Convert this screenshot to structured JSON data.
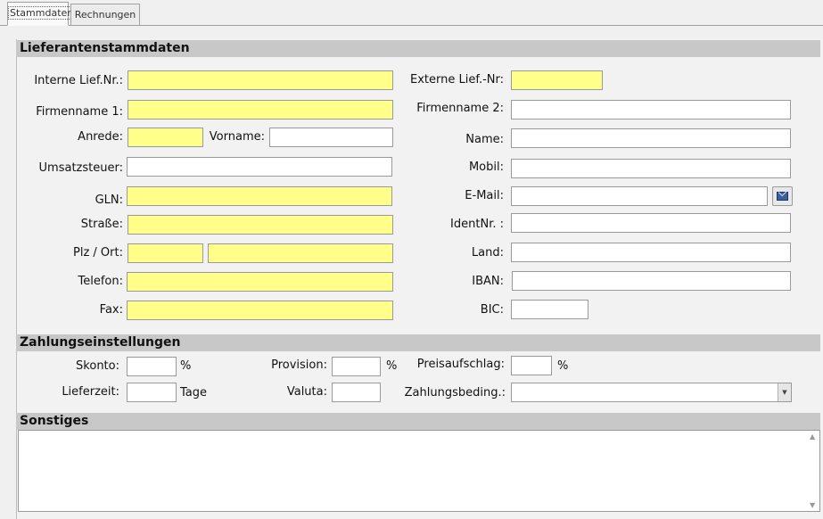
{
  "tabs": [
    {
      "label": "Stammdaten",
      "active": true
    },
    {
      "label": "Rechnungen",
      "active": false
    }
  ],
  "sections": {
    "stamm": "Lieferantenstammdaten",
    "zahlung": "Zahlungseinstellungen",
    "sonstiges": "Sonstiges"
  },
  "labels": {
    "interne_lief_nr": "Interne Lief.Nr.:",
    "externe_lief_nr": "Externe Lief.-Nr:",
    "firmenname1": "Firmenname 1:",
    "firmenname2": "Firmenname 2:",
    "anrede": "Anrede:",
    "vorname": "Vorname:",
    "name": "Name:",
    "umsatzsteuer": "Umsatzsteuer:",
    "mobil": "Mobil:",
    "gln": "GLN:",
    "email": "E-Mail:",
    "strasse": "Straße:",
    "identnr": "IdentNr. :",
    "plz_ort": "Plz / Ort:",
    "land": "Land:",
    "telefon": "Telefon:",
    "iban": "IBAN:",
    "fax": "Fax:",
    "bic": "BIC:",
    "skonto": "Skonto:",
    "provision": "Provision:",
    "preisaufschlag": "Preisaufschlag:",
    "lieferzeit": "Lieferzeit:",
    "valuta": "Valuta:",
    "zahlungsbeding": "Zahlungsbeding.:",
    "percent": "%",
    "tage": "Tage"
  },
  "values": {
    "interne_lief_nr": "",
    "externe_lief_nr": "",
    "firmenname1": "",
    "firmenname2": "",
    "anrede": "",
    "vorname": "",
    "name": "",
    "umsatzsteuer": "",
    "mobil": "",
    "gln": "",
    "email": "",
    "strasse": "",
    "identnr": "",
    "plz": "",
    "ort": "",
    "land": "",
    "telefon": "",
    "iban": "",
    "fax": "",
    "bic": "",
    "skonto": "",
    "provision": "",
    "preisaufschlag": "",
    "lieferzeit": "",
    "valuta": "",
    "zahlungsbeding": "",
    "sonstiges": ""
  },
  "colors": {
    "required": "#ffff8a",
    "section": "#c8c8c8",
    "background": "#f0f0f0"
  },
  "icons": {
    "email_button": "envelope-icon",
    "dropdown": "chevron-down-icon"
  }
}
